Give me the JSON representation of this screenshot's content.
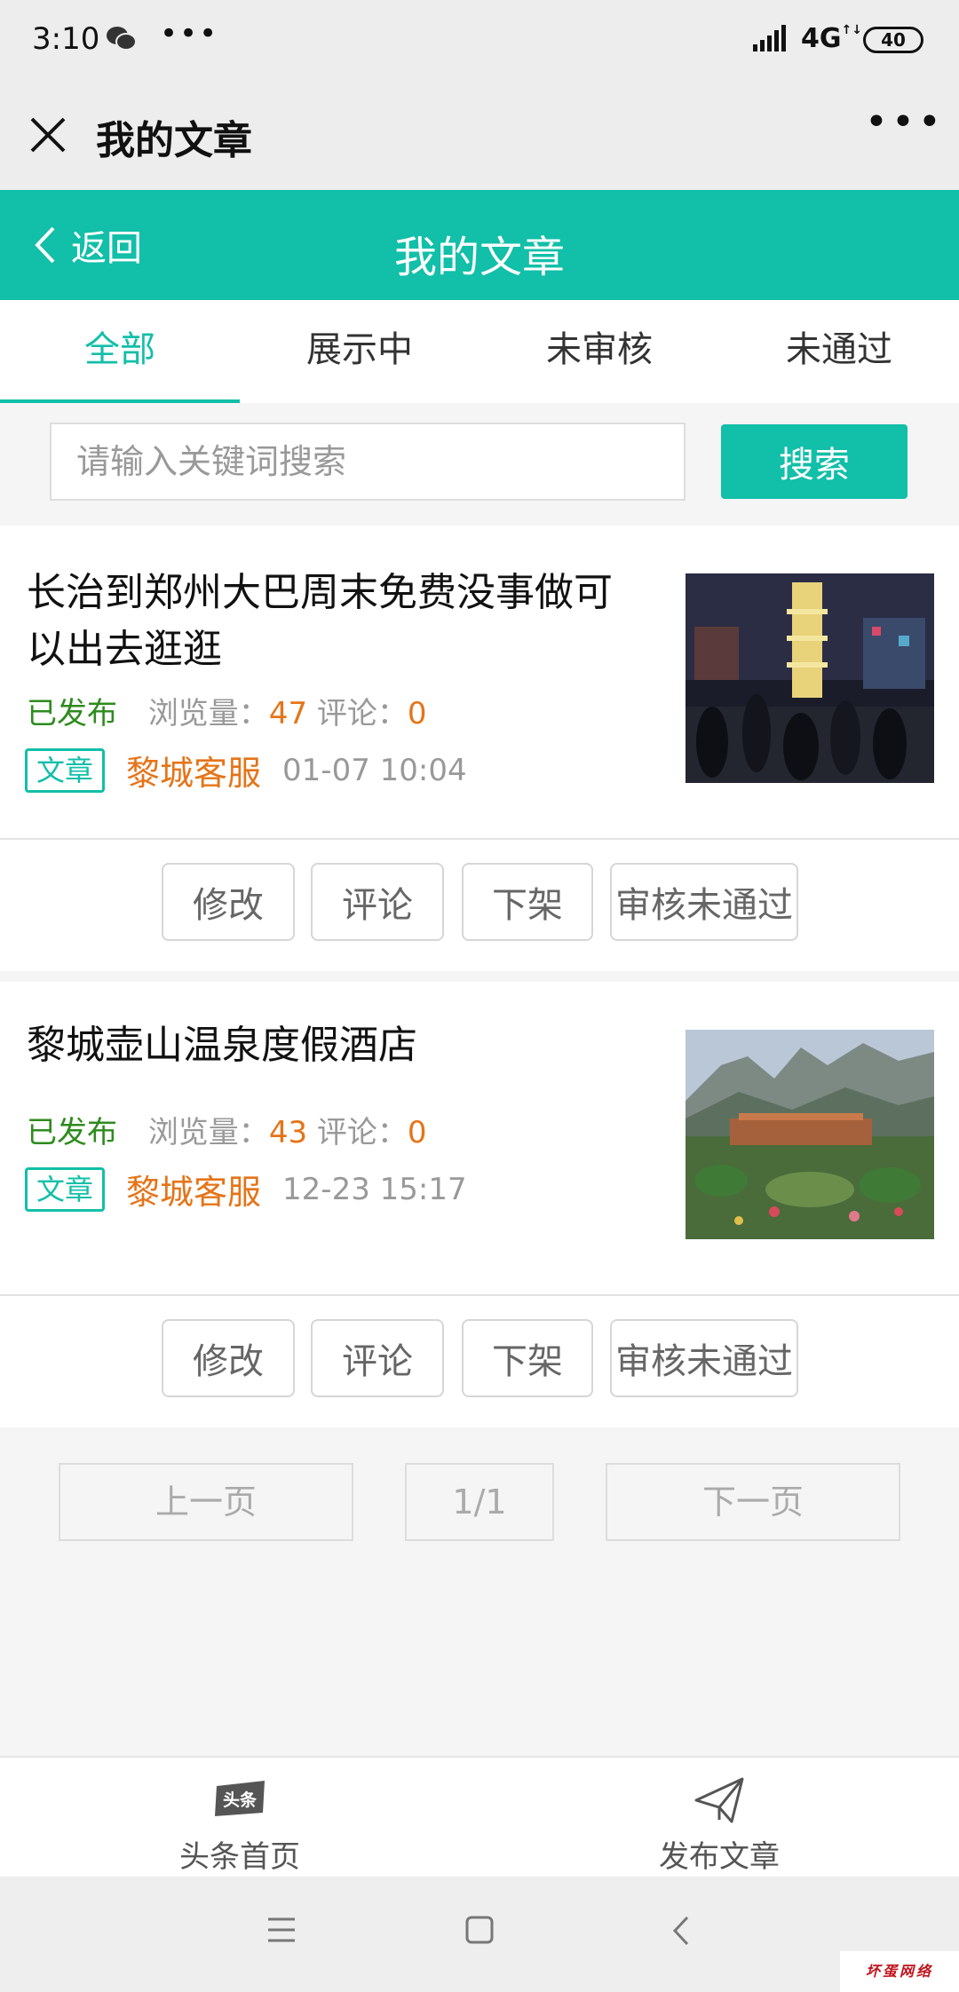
{
  "status_bar": {
    "time": "3:10",
    "network": "4G",
    "battery": "40"
  },
  "wechat_header": {
    "title": "我的文章"
  },
  "nav": {
    "back_label": "返回",
    "title": "我的文章"
  },
  "tabs": [
    {
      "label": "全部",
      "active": true
    },
    {
      "label": "展示中",
      "active": false
    },
    {
      "label": "未审核",
      "active": false
    },
    {
      "label": "未通过",
      "active": false
    }
  ],
  "search": {
    "placeholder": "请输入关键词搜索",
    "button_label": "搜索"
  },
  "articles": [
    {
      "title": "长治到郑州大巴周末免费没事做可以出去逛逛",
      "status": "已发布",
      "views_label": "浏览量：",
      "views": "47",
      "comments_label": "评论：",
      "comments": "0",
      "badge": "文章",
      "author": "黎城客服",
      "time": "01-07 10:04",
      "actions": [
        "修改",
        "评论",
        "下架",
        "审核未通过"
      ]
    },
    {
      "title": "黎城壶山温泉度假酒店",
      "status": "已发布",
      "views_label": "浏览量：",
      "views": "43",
      "comments_label": "评论：",
      "comments": "0",
      "badge": "文章",
      "author": "黎城客服",
      "time": "12-23 15:17",
      "actions": [
        "修改",
        "评论",
        "下架",
        "审核未通过"
      ]
    }
  ],
  "watermark": "坏蛋网络",
  "pagination": {
    "prev": "上一页",
    "page": "1/1",
    "next": "下一页"
  },
  "bottom_tabs": [
    {
      "label": "头条首页",
      "icon": "toutiao-icon",
      "icon_text": "头条"
    },
    {
      "label": "发布文章",
      "icon": "paper-plane-icon"
    }
  ],
  "corner_watermark": "坏蛋网络",
  "colors": {
    "accent": "#12bfa8",
    "published": "#2e8b1e",
    "highlight": "#e57418",
    "watermark": "#b5121b"
  }
}
